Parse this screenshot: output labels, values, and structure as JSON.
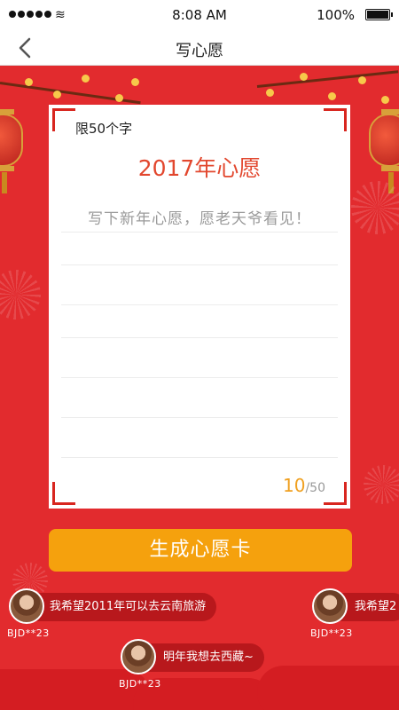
{
  "status_bar": {
    "time": "8:08 AM",
    "battery": "100%"
  },
  "nav": {
    "title": "写心愿"
  },
  "card": {
    "limit_label": "限50个字",
    "title": "2017年心愿",
    "wish_text": "写下新年心愿，愿老天爷看见！",
    "count_current": "10",
    "count_max": "/50"
  },
  "generate_button": {
    "label": "生成心愿卡"
  },
  "danmaku": [
    {
      "text": "我希望2011年可以去云南旅游",
      "user": "BJD**23"
    },
    {
      "text": "我希望2",
      "user": "BJD**23"
    },
    {
      "text": "明年我想去西藏~",
      "user": "BJD**23"
    }
  ],
  "colors": {
    "background": "#e22b2e",
    "accent": "#f5a10d",
    "title": "#e2472e"
  }
}
